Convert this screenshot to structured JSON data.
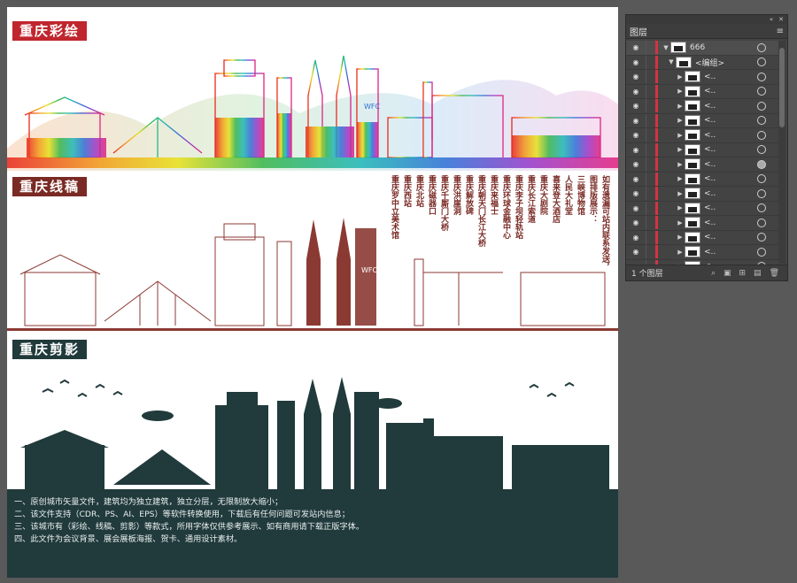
{
  "canvas": {
    "section1_label": "重庆彩绘",
    "section2_label": "重庆线稿",
    "section3_label": "重庆剪影",
    "vertical_text": [
      "如有遗漏可站内联系发送，",
      "图排版展示：",
      "三峡博物馆",
      "人民大礼堂",
      "喜来登大酒店",
      "重庆大剧院",
      "重庆长江索道",
      "重庆李子坝轻轨站",
      "重庆环球金融中心",
      "重庆来福士",
      "重庆朝天门长江大桥",
      "重庆解放碑",
      "重庆洪崖洞",
      "重庆千厮门大桥",
      "重庆磁器口",
      "重庆北站",
      "重庆西站",
      "重庆罗中立美术馆"
    ],
    "building_text": "WFC",
    "notes": [
      "一、原创城市矢量文件，建筑均为独立建筑，独立分层，无限制放大缩小；",
      "二、该文件支持（CDR、PS、AI、EPS）等软件转换使用，下载后有任何问题可发站内信息；",
      "三、该城市有（彩绘、线稿、剪影）等款式，所用字体仅供参考展示、如有商用请下载正版字体。",
      "四、此文件为会议背景、展会展板海报、贺卡、通用设计素材。"
    ]
  },
  "layers_panel": {
    "tab_label": "图层",
    "top_layer_name": "666",
    "group_name": "<编组>",
    "sublayer_name": "<..",
    "sublayer_count": 14,
    "targeted_row": 6,
    "footer_count": "1 个图层"
  }
}
